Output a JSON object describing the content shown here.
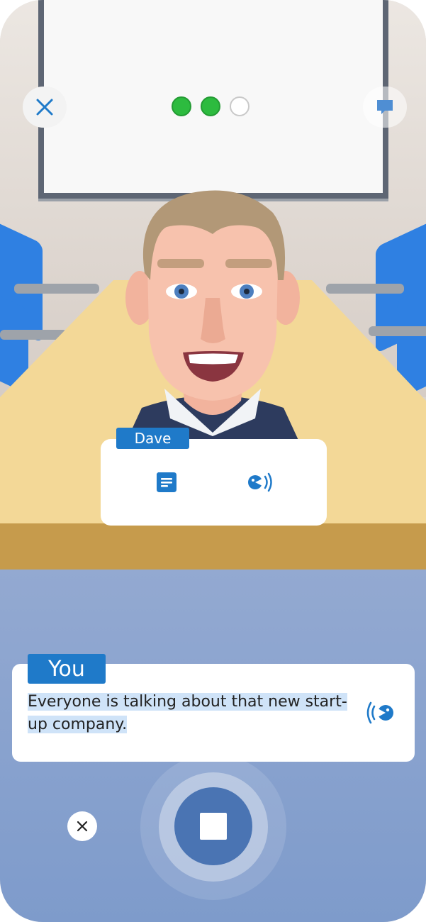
{
  "topbar": {
    "close_icon": "close-icon",
    "hint_icon": "speech-bubble-icon",
    "progress": {
      "completed": 2,
      "total": 3
    }
  },
  "npc_card": {
    "speaker": "Dave",
    "icons": [
      "transcript-icon",
      "play-audio-icon"
    ]
  },
  "user_card": {
    "speaker": "You",
    "text": "Everyone is talking about that new start-up company.",
    "icon": "play-audio-icon"
  },
  "controls": {
    "cancel_icon": "close-icon",
    "record_icon": "stop-icon"
  },
  "colors": {
    "accent": "#1f7ac9",
    "progress_done": "#2dbb3f",
    "record_button": "#4a74b3",
    "text_highlight": "#cfe3f8"
  }
}
